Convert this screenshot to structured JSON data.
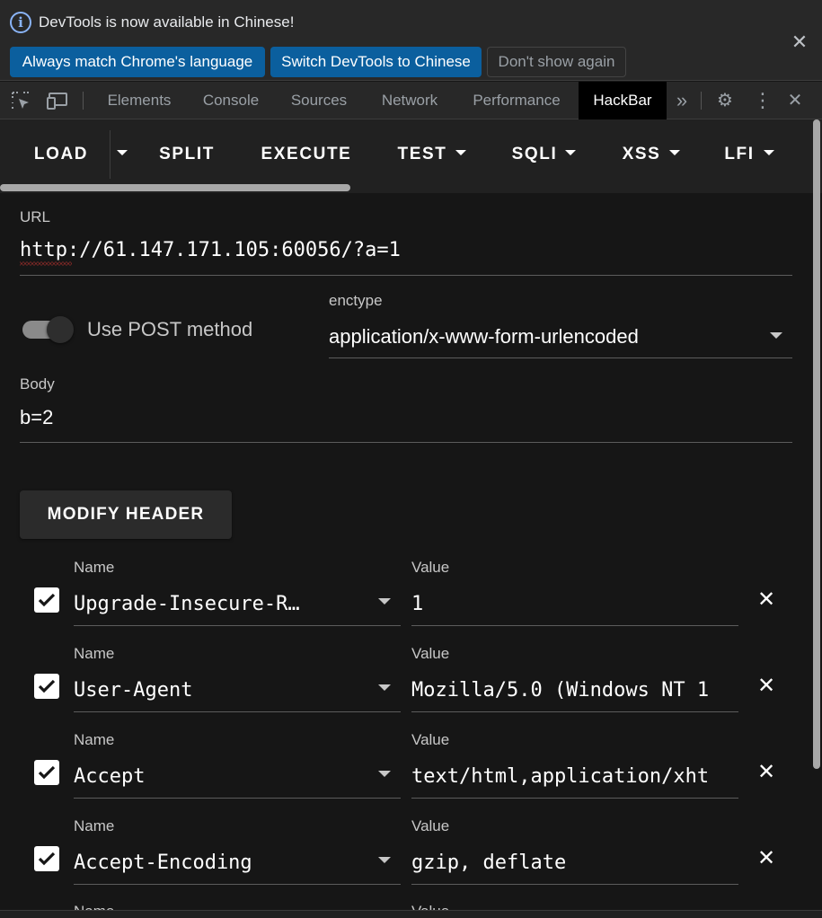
{
  "infobar": {
    "icon": "info-icon",
    "message": "DevTools is now available in Chinese!",
    "buttons": [
      "Always match Chrome's language",
      "Switch DevTools to Chinese",
      "Don't show again"
    ],
    "close_icon": "close-icon"
  },
  "devtools_tabs": [
    "Elements",
    "Console",
    "Sources",
    "Network",
    "Performance",
    "HackBar"
  ],
  "active_tab": "HackBar",
  "hackbar_toolbar": {
    "buttons": [
      "LOAD",
      "SPLIT",
      "EXECUTE",
      "TEST",
      "SQLI",
      "XSS",
      "LFI"
    ]
  },
  "url": {
    "label": "URL",
    "value": "http://61.147.171.105:60056/?a=1"
  },
  "post": {
    "label": "Use POST method",
    "enabled": true
  },
  "enctype": {
    "label": "enctype",
    "value": "application/x-www-form-urlencoded"
  },
  "body": {
    "label": "Body",
    "value": "b=2"
  },
  "modify_header_label": "MODIFY HEADER",
  "headers": [
    {
      "name_label": "Name",
      "name": "Upgrade-Insecure-R…",
      "value_label": "Value",
      "value": "1",
      "checked": true
    },
    {
      "name_label": "Name",
      "name": "User-Agent",
      "value_label": "Value",
      "value": "Mozilla/5.0 (Windows NT 1",
      "checked": true
    },
    {
      "name_label": "Name",
      "name": "Accept",
      "value_label": "Value",
      "value": "text/html,application/xht",
      "checked": true
    },
    {
      "name_label": "Name",
      "name": "Accept-Encoding",
      "value_label": "Value",
      "value": "gzip, deflate",
      "checked": true
    },
    {
      "name_label": "Name",
      "value_label": "Value"
    }
  ],
  "colors": {
    "primary_button": "#0b5f9e",
    "active_tab_bg": "#000000",
    "panel_bg": "#161616"
  }
}
